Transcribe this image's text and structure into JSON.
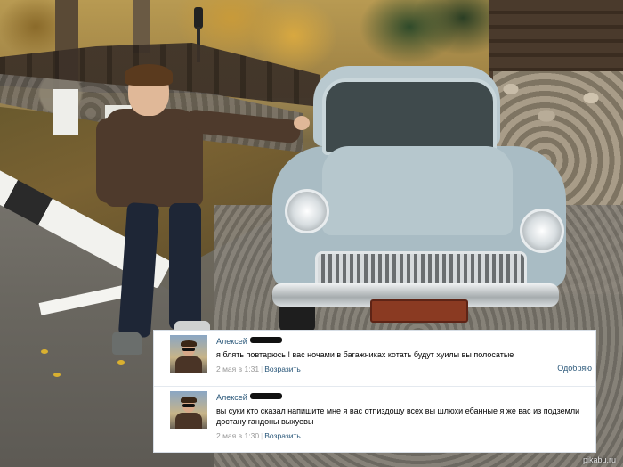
{
  "photo": {
    "description_icon": "photo-scene"
  },
  "comments": [
    {
      "author": "Алексей",
      "text": "я блять повтарюсь ! вас ночами в багажниках котать будут хуилы вы полосатые",
      "date": "2 мая в 1:31",
      "reply_label": "Возразить",
      "like_label": "Одобряю"
    },
    {
      "author": "Алексей",
      "text": "вы суки кто сказал напишите мне я вас отпиздошу всех вы шлюхи ебанные я же вас из подземли достану гандоны выхуевы",
      "date": "2 мая в 1:30",
      "reply_label": "Возразить"
    }
  ],
  "watermark": "pikabu.ru",
  "colors": {
    "link": "#2b587a",
    "meta": "#999999",
    "card_border": "#d7dee6"
  }
}
